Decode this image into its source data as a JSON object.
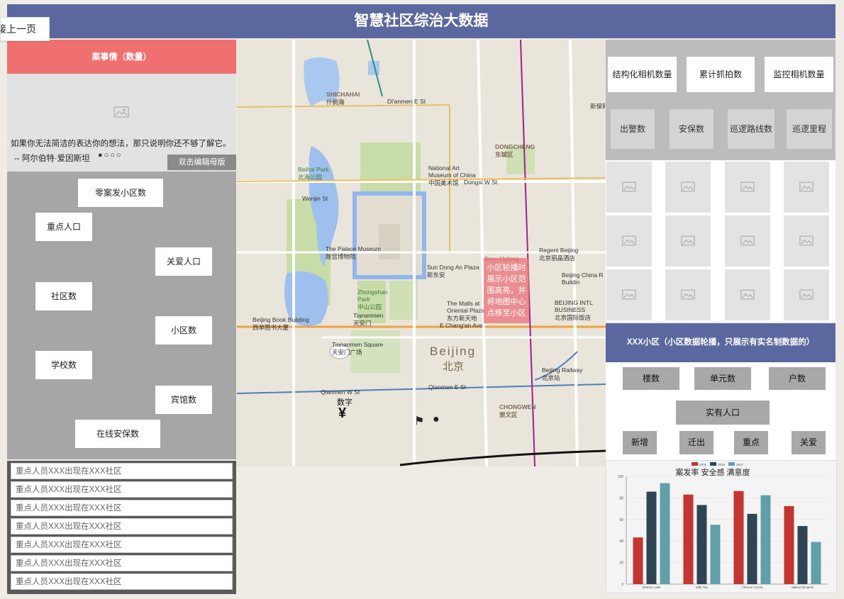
{
  "header": {
    "title": "智慧社区综治大数据",
    "back_label": "接上一页"
  },
  "case": {
    "header": "案事情（数量）",
    "quote": "如果你无法简洁的表达你的想法，那只说明你还不够了解它。",
    "author": "-- 阿尔伯特·爱因斯坦",
    "dots": "●○○○",
    "edit_label": "双击编辑母版"
  },
  "stats": {
    "zero_case": "零案发小区数",
    "key_people": "重点人口",
    "care_people": "关爱人口",
    "community_count": "社区数",
    "estate_count": "小区数",
    "school_count": "学校数",
    "hotel_count": "宾馆数",
    "security_count": "在线安保数"
  },
  "alerts": [
    "重点人员XXX出现在XXX社区",
    "重点人员XXX出现在XXX社区",
    "重点人员XXX出现在XXX社区",
    "重点人员XXX出现在XXX社区",
    "重点人员XXX出现在XXX社区",
    "重点人员XXX出现在XXX社区",
    "重点人员XXX出现在XXX社区"
  ],
  "map": {
    "callout": "小区轮播时展示小区范围高亮，并将地图中心点移至小区",
    "number_label": "数字",
    "labels": {
      "beihai": "Beihai Park\n北海公园",
      "museum": "The Palace Museum\n故宫博物院",
      "nam": "National Art\nMuseum of China\n中国美术馆",
      "beijing": "Beijing",
      "beijing_cn": "北京",
      "tiananmen": "Tiananmen\n天安门",
      "square": "Tiananmen Square\n天安门广场",
      "dongcheng": "DONGCHENG\n东城区",
      "chongwen": "CHONGWEN\n崇文区",
      "shichahai": "SHICHAHAI\n什刹海",
      "zhongshan": "Zhongshan\nPark\n中山公园",
      "book": "Beijing Book Building\n西单图书大厦",
      "regent": "Regent Beijing\n北京丽晶酒店",
      "railway": "Beijing Railway\n北京站",
      "intl": "BEIJING INTL\nBUSINESS\n北京国际饭店",
      "malls": "The Malls at\nOriental Plaza\n东方新天地",
      "sundong": "Sun Dong An Plaza\n新东安",
      "chinaR": "Beijing China R\nBuildin",
      "jinyu": "Jinyu Hutong",
      "dianmen": "Di'anmen E St",
      "changan": "E Chang'an Ave",
      "qianmen": "Qianmen E St",
      "qianmenW": "Qianmen W St",
      "dongsi": "Dongsi W St",
      "wenjin": "Wenjin St",
      "xinbao": "新保利大厦"
    }
  },
  "cameras": {
    "structured": "结构化相机数量",
    "captures": "累计抓拍数",
    "monitor": "监控相机数量",
    "dispatch": "出警数",
    "security": "安保数",
    "patrol_routes": "巡逻路线数",
    "patrol_distance": "巡逻里程"
  },
  "community": {
    "header": "XXX小区（小区数据轮播，只展示有实名制数据的）",
    "buildings": "楼数",
    "units": "单元数",
    "households": "户数",
    "population": "实有人口",
    "new": "新增",
    "moved_out": "迁出",
    "key": "重点",
    "care": "关爱"
  },
  "chart_data": {
    "type": "bar",
    "title": "案发率 安全感 满意度",
    "categories": [
      "Matcha Latte",
      "Milk Tea",
      "Cheese Cocoa",
      "Walnut Brownie"
    ],
    "series": [
      {
        "name": "2015",
        "color": "#c23531",
        "values": [
          43.3,
          83.1,
          86.4,
          72.4
        ]
      },
      {
        "name": "2016",
        "color": "#2f4554",
        "values": [
          85.8,
          73.4,
          65.2,
          53.9
        ]
      },
      {
        "name": "2017",
        "color": "#61a0a8",
        "values": [
          93.7,
          55.1,
          82.5,
          39.1
        ]
      }
    ],
    "ylim": [
      0,
      100
    ],
    "yticks": [
      0,
      20,
      40,
      60,
      80,
      100
    ]
  }
}
